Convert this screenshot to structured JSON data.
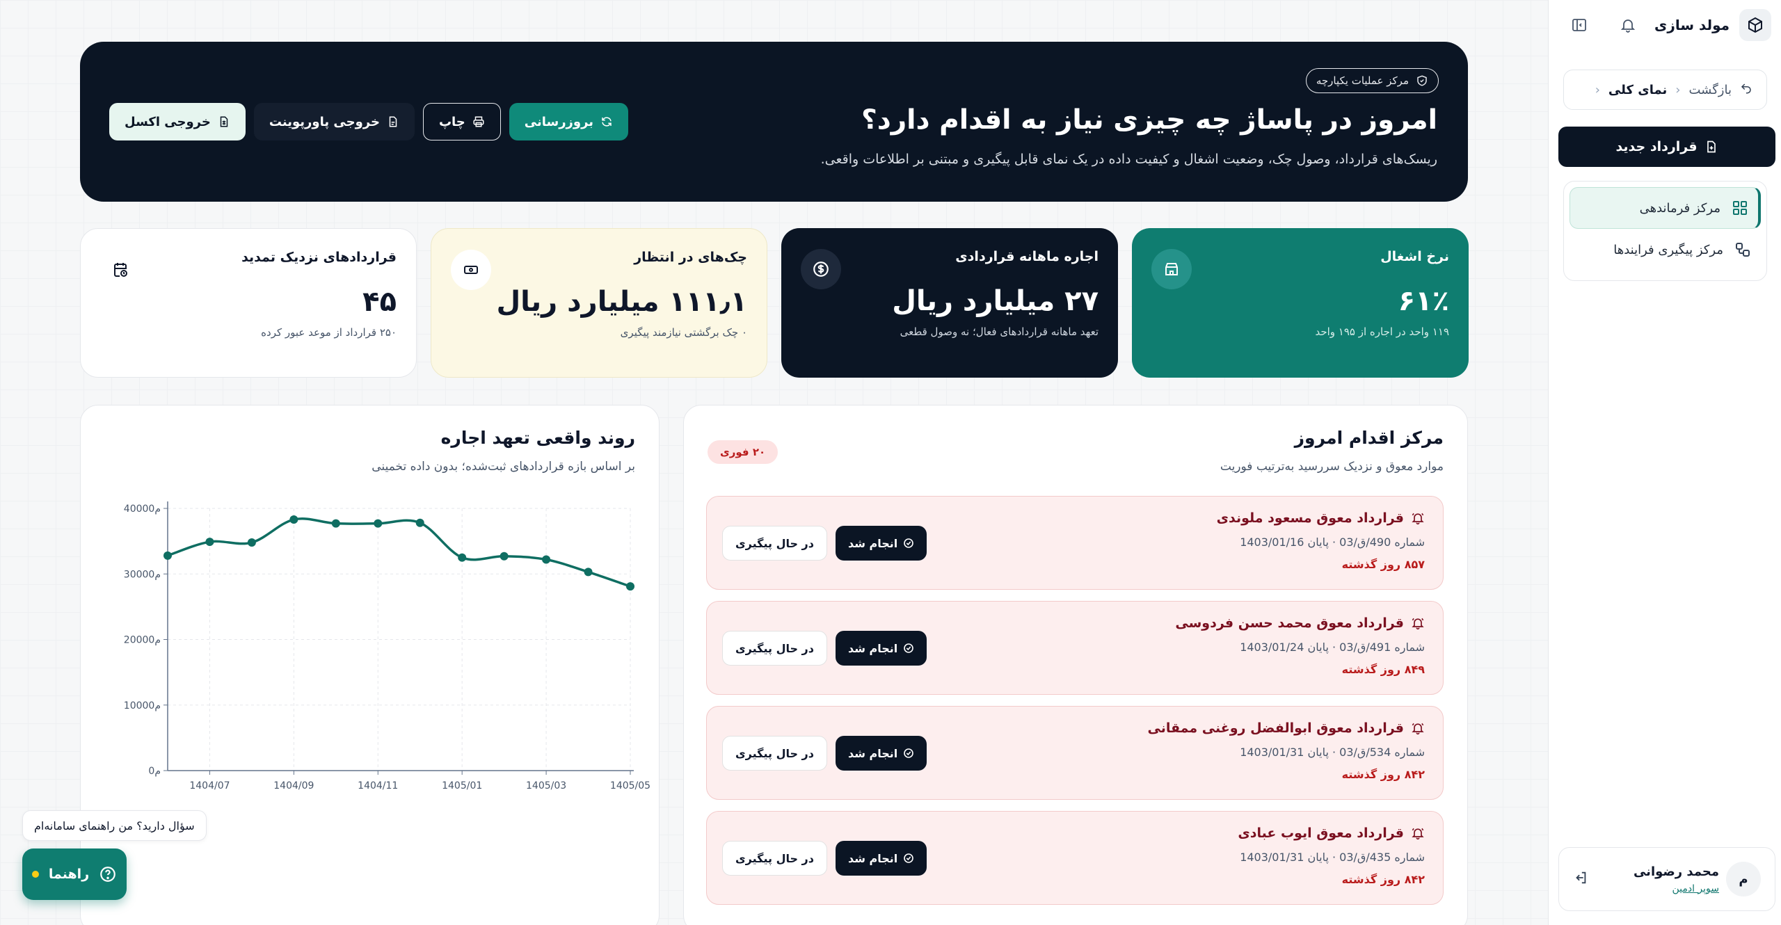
{
  "sidebar": {
    "brand": "مولد سازی",
    "breadcrumb": {
      "back": "بازگشت",
      "current": "نمای کلی"
    },
    "new_contract": "قرارداد جدید",
    "nav": [
      {
        "label": "مرکز فرماندهی",
        "icon": "grid-icon",
        "active": true
      },
      {
        "label": "مرکز پیگیری فرایندها",
        "icon": "workflow-icon",
        "active": false
      }
    ],
    "user": {
      "name": "محمد رضوانی",
      "role": "سوپر ادمین",
      "initial": "م"
    }
  },
  "hero": {
    "badge": "مرکز عملیات یکپارچه",
    "title": "امروز در پاساژ چه چیزی نیاز به اقدام دارد؟",
    "subtitle": "ریسک‌های قرارداد، وصول چک، وضعیت اشغال و کیفیت داده در یک نمای قابل پیگیری و مبتنی بر اطلاعات واقعی.",
    "actions": {
      "excel": "خروجی اکسل",
      "powerpoint": "خروجی پاورپوینت",
      "print": "چاپ",
      "refresh": "بروزرسانی"
    }
  },
  "kpis": [
    {
      "title": "نرخ اشغال",
      "value": "۶۱٪",
      "note": "۱۱۹ واحد در اجاره از ۱۹۵ واحد",
      "icon": "store-icon"
    },
    {
      "title": "اجاره ماهانه قراردادی",
      "value": "۲۷ میلیارد ریال",
      "note": "تعهد ماهانه قراردادهای فعال؛ نه وصول قطعی",
      "icon": "dollar-icon"
    },
    {
      "title": "چک‌های در انتظار",
      "value": "۱۱۱٫۱ میلیارد ریال",
      "note": "۰ چک برگشتی نیازمند پیگیری",
      "icon": "banknote-icon"
    },
    {
      "title": "قراردادهای نزدیک تمدید",
      "value": "۴۵",
      "note": "۲۵۰ قرارداد از موعد عبور کرده",
      "icon": "calendar-clock-icon"
    }
  ],
  "action_center": {
    "title": "مرکز اقدام امروز",
    "subtitle": "موارد معوق و نزدیک سررسید به‌ترتیب فوریت",
    "urgent_badge": "۲۰ فوری",
    "in_progress_label": "در حال پیگیری",
    "done_label": "انجام شد",
    "items": [
      {
        "title": "قرارداد معوق مسعود ملوندی",
        "meta": "شماره 490/ق/03 · پایان 1403/01/16",
        "days": "۸۵۷ روز گذشته"
      },
      {
        "title": "قرارداد معوق محمد حسن فردوسی",
        "meta": "شماره 491/ق/03 · پایان 1403/01/24",
        "days": "۸۴۹ روز گذشته"
      },
      {
        "title": "قرارداد معوق ابوالفضل روغنی ممقانی",
        "meta": "شماره 534/ق/03 · پایان 1403/01/31",
        "days": "۸۴۲ روز گذشته"
      },
      {
        "title": "قرارداد معوق ایوب عبادی",
        "meta": "شماره 435/ق/03 · پایان 1403/01/31",
        "days": "۸۴۲ روز گذشته"
      }
    ]
  },
  "chart_panel": {
    "title": "روند واقعی تعهد اجاره",
    "subtitle": "بر اساس بازه قراردادهای ثبت‌شده؛ بدون داده تخمینی"
  },
  "chart_data": {
    "type": "line",
    "x": [
      "1404/06",
      "1404/07",
      "1404/08",
      "1404/09",
      "1404/10",
      "1404/11",
      "1404/12",
      "1405/01",
      "1405/02",
      "1405/03",
      "1405/04",
      "1405/05"
    ],
    "x_tick_labels": [
      "1404/07",
      "1404/09",
      "1404/11",
      "1405/01",
      "1405/03",
      "1405/05"
    ],
    "y_tick_labels": [
      "0م",
      "10000م",
      "20000م",
      "30000م",
      "40000م"
    ],
    "series": [
      {
        "values": [
          32800,
          34900,
          34800,
          38300,
          37700,
          37700,
          37800,
          32500,
          32700,
          32200,
          30300,
          28100
        ]
      }
    ],
    "ylim": [
      0,
      40000
    ],
    "grid": true,
    "color": "#0f6e62"
  },
  "help": {
    "tip": "سؤال دارید؟ من راهنمای سامانه‌ام",
    "button": "راهنما"
  }
}
